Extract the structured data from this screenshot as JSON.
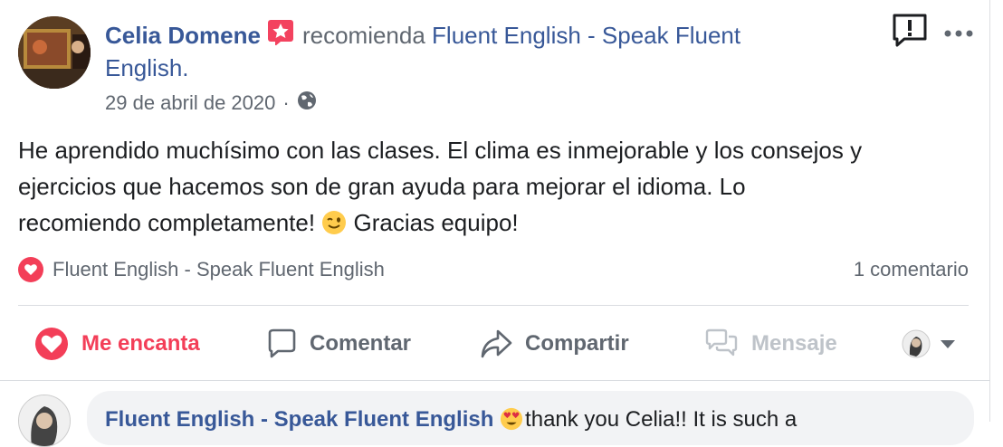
{
  "post": {
    "author": "Celia Domene",
    "action_text": "recomienda",
    "page_name_line1": "Fluent English - Speak Fluent",
    "page_name_line2": "English.",
    "date": "29 de abril de 2020",
    "separator": "·",
    "body_line1": "He aprendido muchísimo con las clases. El clima es inmejorable y los consejos y",
    "body_line2": "ejercicios que hacemos son de gran ayuda para mejorar el idioma. Lo",
    "body_line3a": "recomiendo completamente!",
    "body_line3b": "Gracias equipo!"
  },
  "reactions": {
    "reactor": "Fluent English - Speak Fluent English",
    "comments_count": "1 comentario"
  },
  "actions": {
    "love": "Me encanta",
    "comment": "Comentar",
    "share": "Compartir",
    "message": "Mensaje"
  },
  "comment": {
    "author": "Fluent English - Speak Fluent English",
    "text": "thank you Celia!! It is such a"
  },
  "colors": {
    "link": "#385898",
    "love": "#f33e58",
    "muted": "#606770",
    "disabled": "#bec3c9"
  },
  "icons": [
    "recommend-badge-icon",
    "globe-icon",
    "report-icon",
    "more-icon",
    "heart-icon",
    "comment-icon",
    "share-icon",
    "message-icon",
    "chevron-down-icon",
    "wink-emoji-icon",
    "heart-eyes-emoji-icon"
  ]
}
